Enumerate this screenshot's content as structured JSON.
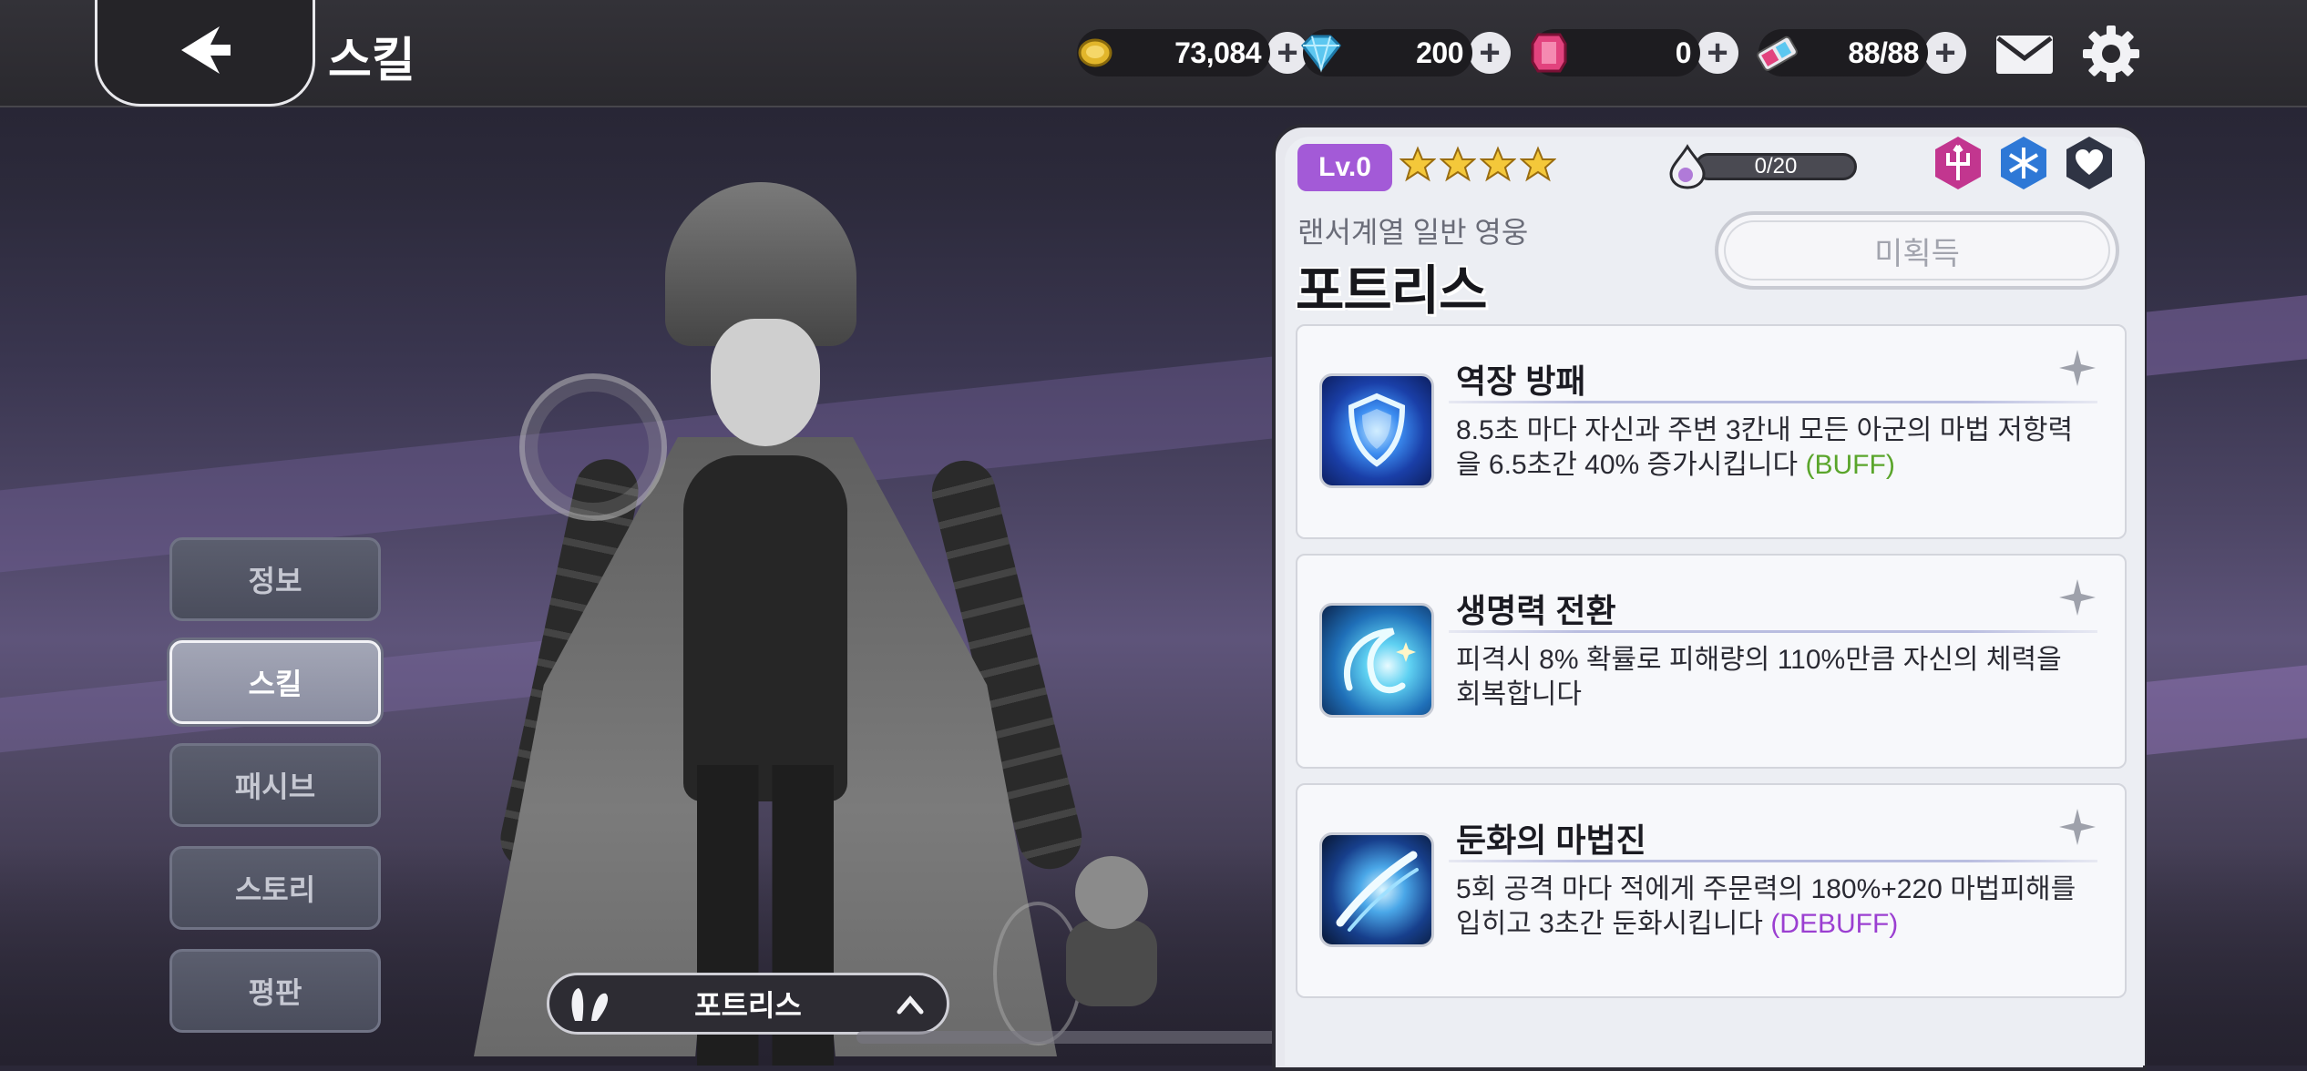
{
  "header": {
    "title": "스킬",
    "resources": [
      {
        "name": "gold",
        "value": "73,084",
        "icon": "gold-coin-icon"
      },
      {
        "name": "diamond",
        "value": "200",
        "icon": "diamond-icon"
      },
      {
        "name": "ruby",
        "value": "0",
        "icon": "ruby-gem-icon"
      },
      {
        "name": "stamina",
        "value": "88/88",
        "icon": "stamina-ticket-icon"
      }
    ],
    "plus_label": "+"
  },
  "sidebar": {
    "tabs": [
      {
        "label": "정보",
        "active": false
      },
      {
        "label": "스킬",
        "active": true
      },
      {
        "label": "패시브",
        "active": false
      },
      {
        "label": "스토리",
        "active": false
      },
      {
        "label": "평판",
        "active": false
      }
    ]
  },
  "hero_selector": {
    "name": "포트리스",
    "icon": "bunny-ears-icon",
    "toggle_icon": "chevron-up-icon"
  },
  "hero": {
    "level": "Lv.0",
    "stars": 4,
    "xp": "0/20",
    "class_line": "랜서계열 일반 영웅",
    "name": "포트리스",
    "status_button": "미획득",
    "element_icons": [
      "trident-icon",
      "snowflake-icon",
      "heart-icon"
    ],
    "colors": {
      "level_bg": "#a35ad7",
      "buff": "#5aa52b",
      "debuff": "#9b3fd1"
    }
  },
  "skills": [
    {
      "name": "역장 방패",
      "desc": "8.5초 마다 자신과 주변 3칸내 모든 아군의 마법 저항력을 6.5초간 40% 증가시킵니다",
      "tag": "(BUFF)",
      "tag_type": "buff",
      "icon": "shield-skill-icon"
    },
    {
      "name": "생명력 전환",
      "desc": "피격시 8% 확률로 피해량의 110%만큼 자신의 체력을 회복합니다",
      "tag": "",
      "tag_type": "",
      "icon": "swirl-skill-icon"
    },
    {
      "name": "둔화의 마법진",
      "desc": "5회 공격 마다 적에게 주문력의 180%+220 마법피해를 입히고 3초간 둔화시킵니다",
      "tag": "(DEBUFF)",
      "tag_type": "debuff",
      "icon": "slash-skill-icon"
    }
  ]
}
